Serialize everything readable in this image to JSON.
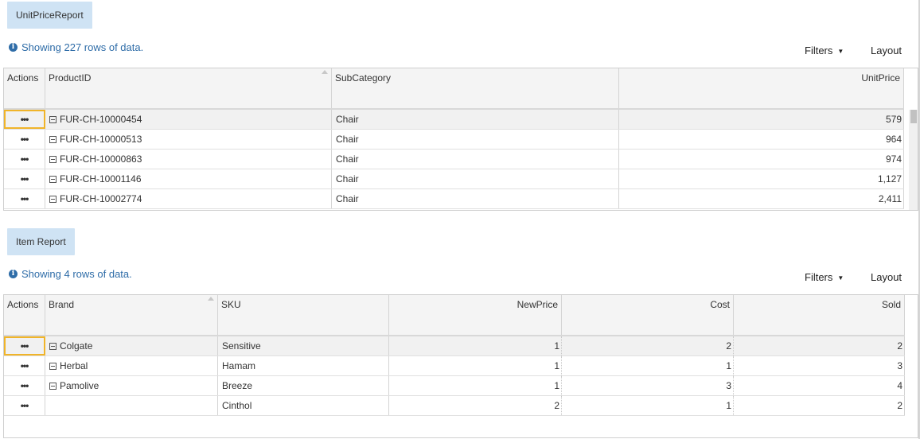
{
  "report1": {
    "button_label": "UnitPriceReport",
    "info_text": "Showing 227 rows of data.",
    "filters_label": "Filters",
    "layout_label": "Layout",
    "columns": [
      "Actions",
      "ProductID",
      "SubCategory",
      "UnitPrice"
    ],
    "rows": [
      {
        "actions": "•••",
        "product_id": "FUR-CH-10000454",
        "subcategory": "Chair",
        "unit_price": "579"
      },
      {
        "actions": "•••",
        "product_id": "FUR-CH-10000513",
        "subcategory": "Chair",
        "unit_price": "964"
      },
      {
        "actions": "•••",
        "product_id": "FUR-CH-10000863",
        "subcategory": "Chair",
        "unit_price": "974"
      },
      {
        "actions": "•••",
        "product_id": "FUR-CH-10001146",
        "subcategory": "Chair",
        "unit_price": "1,127"
      },
      {
        "actions": "•••",
        "product_id": "FUR-CH-10002774",
        "subcategory": "Chair",
        "unit_price": "2,411"
      }
    ]
  },
  "report2": {
    "button_label": "Item Report",
    "info_text": "Showing 4 rows of data.",
    "filters_label": "Filters",
    "layout_label": "Layout",
    "columns": [
      "Actions",
      "Brand",
      "SKU",
      "NewPrice",
      "Cost",
      "Sold"
    ],
    "rows": [
      {
        "actions": "•••",
        "brand": "Colgate",
        "sku": "Sensitive",
        "new_price": "1",
        "cost": "2",
        "sold": "2"
      },
      {
        "actions": "•••",
        "brand": "Herbal",
        "sku": "Hamam",
        "new_price": "1",
        "cost": "1",
        "sold": "3"
      },
      {
        "actions": "•••",
        "brand": "Pamolive",
        "sku": "Breeze",
        "new_price": "1",
        "cost": "3",
        "sold": "4"
      },
      {
        "actions": "•••",
        "brand": "",
        "sku": "Cinthol",
        "new_price": "2",
        "cost": "1",
        "sold": "2"
      }
    ]
  },
  "icons": {
    "info": "info-circle-icon",
    "expander": "collapse-box-icon",
    "caret": "caret-down-icon",
    "sort": "sort-up-icon"
  },
  "colors": {
    "button_bg": "#cfe3f4",
    "info_text": "#2f6da8",
    "focus_outline": "#f0b429",
    "header_bg": "#f4f4f4"
  }
}
